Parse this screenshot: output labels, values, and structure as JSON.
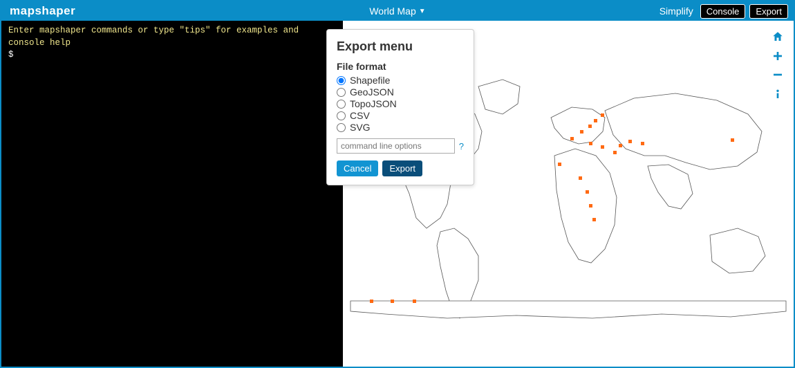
{
  "header": {
    "logo": "mapshaper",
    "layer_name": "World Map",
    "simplify": "Simplify",
    "console": "Console",
    "export": "Export"
  },
  "console": {
    "help_line": "Enter mapshaper commands or type \"tips\" for examples and console help",
    "prompt": "$"
  },
  "export_menu": {
    "title": "Export menu",
    "file_format_label": "File format",
    "options": {
      "shapefile": "Shapefile",
      "geojson": "GeoJSON",
      "topojson": "TopoJSON",
      "csv": "CSV",
      "svg": "SVG"
    },
    "selected": "shapefile",
    "cmd_placeholder": "command line options",
    "help": "?",
    "cancel": "Cancel",
    "export": "Export"
  },
  "map_controls": {
    "home": "home-icon",
    "zoom_in": "plus-icon",
    "zoom_out": "minus-icon",
    "info": "info-icon"
  }
}
